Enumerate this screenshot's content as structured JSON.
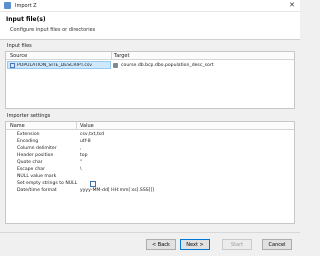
{
  "window": {
    "title": "Import Z"
  },
  "header": {
    "title": "Input file(s)",
    "description": "Configure input files or directories"
  },
  "input_files": {
    "section_label": "Input files",
    "columns": {
      "source": "Source",
      "target": "Target"
    },
    "rows": [
      {
        "source": "POPULATION_SITE_DESCRIPT.csv",
        "target": "course.db.bcp.dbo.population_desc_sort"
      }
    ]
  },
  "importer_settings": {
    "section_label": "Importer settings",
    "columns": {
      "name": "Name",
      "value": "Value"
    },
    "rows": [
      {
        "name": "Extension",
        "value": "csv,txt,tsd"
      },
      {
        "name": "Encoding",
        "value": "utf-8"
      },
      {
        "name": "Column delimiter",
        "value": ","
      },
      {
        "name": "Header position",
        "value": "top"
      },
      {
        "name": "Quote char",
        "value": "\""
      },
      {
        "name": "Escape char",
        "value": "\\"
      },
      {
        "name": "NULL value mark",
        "value": ""
      },
      {
        "name": "Set empty strings to NULL",
        "value": "",
        "checkbox": true,
        "checked": false
      },
      {
        "name": "Date/time format",
        "value": "yyyy-MM-dd[ HH:mm[:ss[.SSS]]]"
      }
    ]
  },
  "footer": {
    "back_label": "< Back",
    "next_label": "Next >",
    "start_label": "Start",
    "cancel_label": "Cancel"
  }
}
